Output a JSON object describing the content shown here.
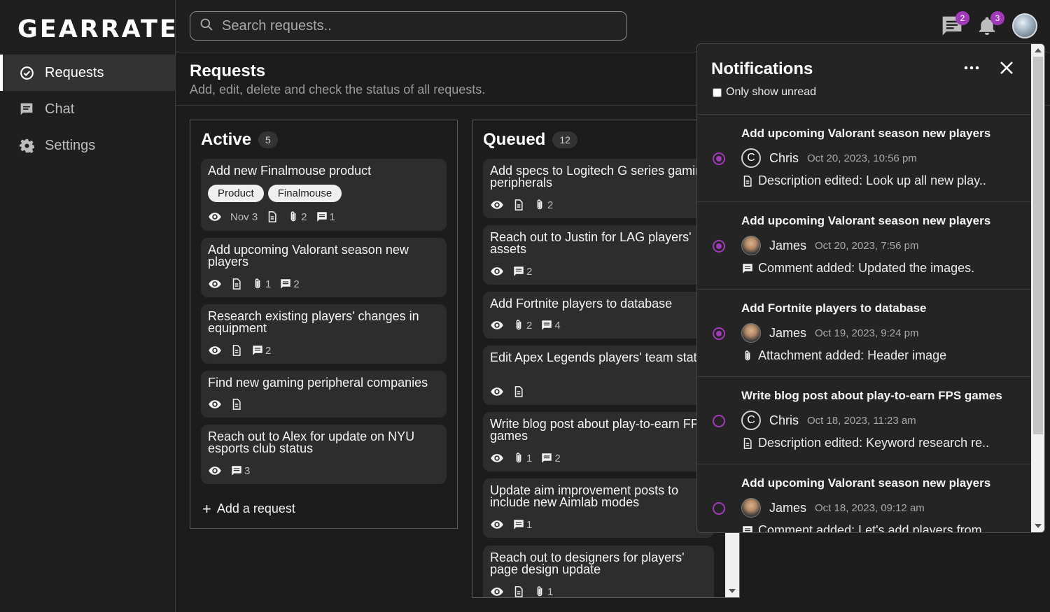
{
  "app": {
    "logo": "GEARRATE"
  },
  "sidebar": {
    "items": [
      {
        "label": "Requests",
        "icon": "check-circle-icon"
      },
      {
        "label": "Chat",
        "icon": "chat-icon"
      },
      {
        "label": "Settings",
        "icon": "gear-icon"
      }
    ]
  },
  "header": {
    "search_placeholder": "Search requests..",
    "chat_badge": "2",
    "bell_badge": "3"
  },
  "page": {
    "title": "Requests",
    "subtitle": "Add, edit, delete and check the status of all requests."
  },
  "columns": {
    "active": {
      "title": "Active",
      "count": "5",
      "add_label": "Add a request",
      "cards": [
        {
          "title": "Add new Finalmouse product",
          "tags": [
            "Product",
            "Finalmouse"
          ],
          "date": "Nov 3",
          "attachments": "2",
          "comments": "1"
        },
        {
          "title": "Add upcoming Valorant season new players",
          "attachments": "1",
          "comments": "2"
        },
        {
          "title": "Research existing players' changes in equipment",
          "comments": "2"
        },
        {
          "title": "Find new gaming peripheral companies"
        },
        {
          "title": "Reach out to Alex for update on NYU esports club status",
          "comments": "3"
        }
      ]
    },
    "queued": {
      "title": "Queued",
      "count": "12",
      "cards": [
        {
          "title": "Add specs to Logitech G series gaming peripherals",
          "attachments": "2"
        },
        {
          "title": "Reach out to Justin for LAG players' assets",
          "comments": "2"
        },
        {
          "title": "Add Fortnite players to database",
          "attachments": "2",
          "comments": "4"
        },
        {
          "title": "Edit Apex Legends players' team status"
        },
        {
          "title": "Write blog post about play-to-earn FPS games",
          "attachments": "1",
          "comments": "2"
        },
        {
          "title": "Update aim improvement posts to include new Aimlab modes",
          "comments": "1"
        },
        {
          "title": "Reach out to designers for players' page design update",
          "attachments": "1"
        }
      ]
    }
  },
  "notifications": {
    "title": "Notifications",
    "only_unread_label": "Only show unread",
    "accent": "#a13ab8",
    "items": [
      {
        "title": "Add upcoming Valorant season new players",
        "user": "Chris",
        "avatar_letter": "C",
        "date": "Oct 20, 2023, 10:56 pm",
        "desc": "Description edited: Look up all new play..",
        "unread": true
      },
      {
        "title": "Add upcoming Valorant season new players",
        "user": "James",
        "date": "Oct 20, 2023, 7:56 pm",
        "desc": "Comment added: Updated the images.",
        "unread": true
      },
      {
        "title": "Add Fortnite players to database",
        "user": "James",
        "date": "Oct 19, 2023, 9:24 pm",
        "desc": "Attachment added: Header image",
        "unread": true
      },
      {
        "title": "Write blog post about play-to-earn FPS games",
        "user": "Chris",
        "avatar_letter": "C",
        "date": "Oct 18, 2023, 11:23 am",
        "desc": "Description edited: Keyword research re..",
        "unread": false
      },
      {
        "title": "Add upcoming Valorant season new players",
        "user": "James",
        "date": "Oct 18, 2023, 09:12 am",
        "desc": "Comment added: Let's add players from",
        "unread": false
      }
    ]
  }
}
